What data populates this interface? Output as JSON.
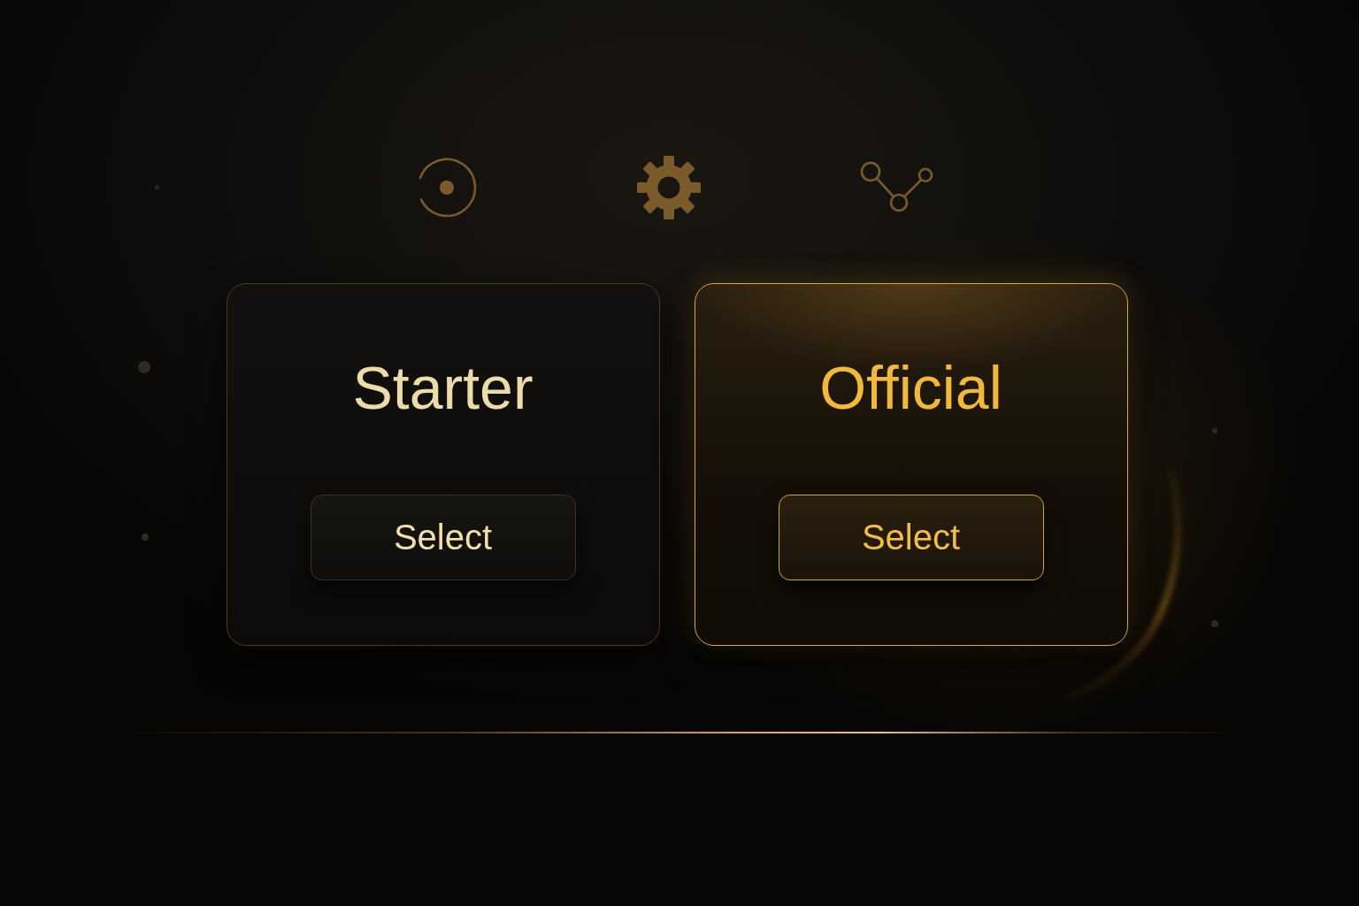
{
  "plans": [
    {
      "title": "Starter",
      "button": "Select",
      "selected": false
    },
    {
      "title": "Official",
      "button": "Select",
      "selected": true
    }
  ]
}
